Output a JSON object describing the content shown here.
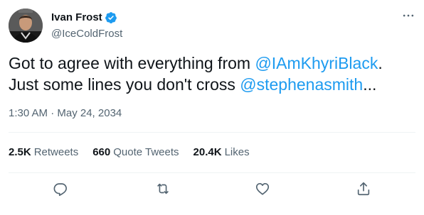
{
  "user": {
    "display_name": "Ivan Frost",
    "handle": "@IceColdFrost"
  },
  "tweet": {
    "text_1": "Got to agree with everything from ",
    "mention_1": "@IAmKhyriBlack",
    "text_2": ".",
    "text_3": "Just some lines you don't cross ",
    "mention_2": "@stephenasmith",
    "text_4": "...",
    "timestamp": "1:30 AM · May 24, 2034"
  },
  "stats": {
    "retweets_count": "2.5K",
    "retweets_label": "Retweets",
    "quotes_count": "660",
    "quotes_label": "Quote Tweets",
    "likes_count": "20.4K",
    "likes_label": "Likes"
  },
  "colors": {
    "accent": "#1d9bf0",
    "text_primary": "#0f1419",
    "text_secondary": "#536471",
    "divider": "#eff3f4"
  },
  "icons": {
    "verified": "verified-badge-icon",
    "more": "more-options-icon",
    "reply": "reply-icon",
    "retweet": "retweet-icon",
    "like": "heart-icon",
    "share": "share-icon"
  }
}
